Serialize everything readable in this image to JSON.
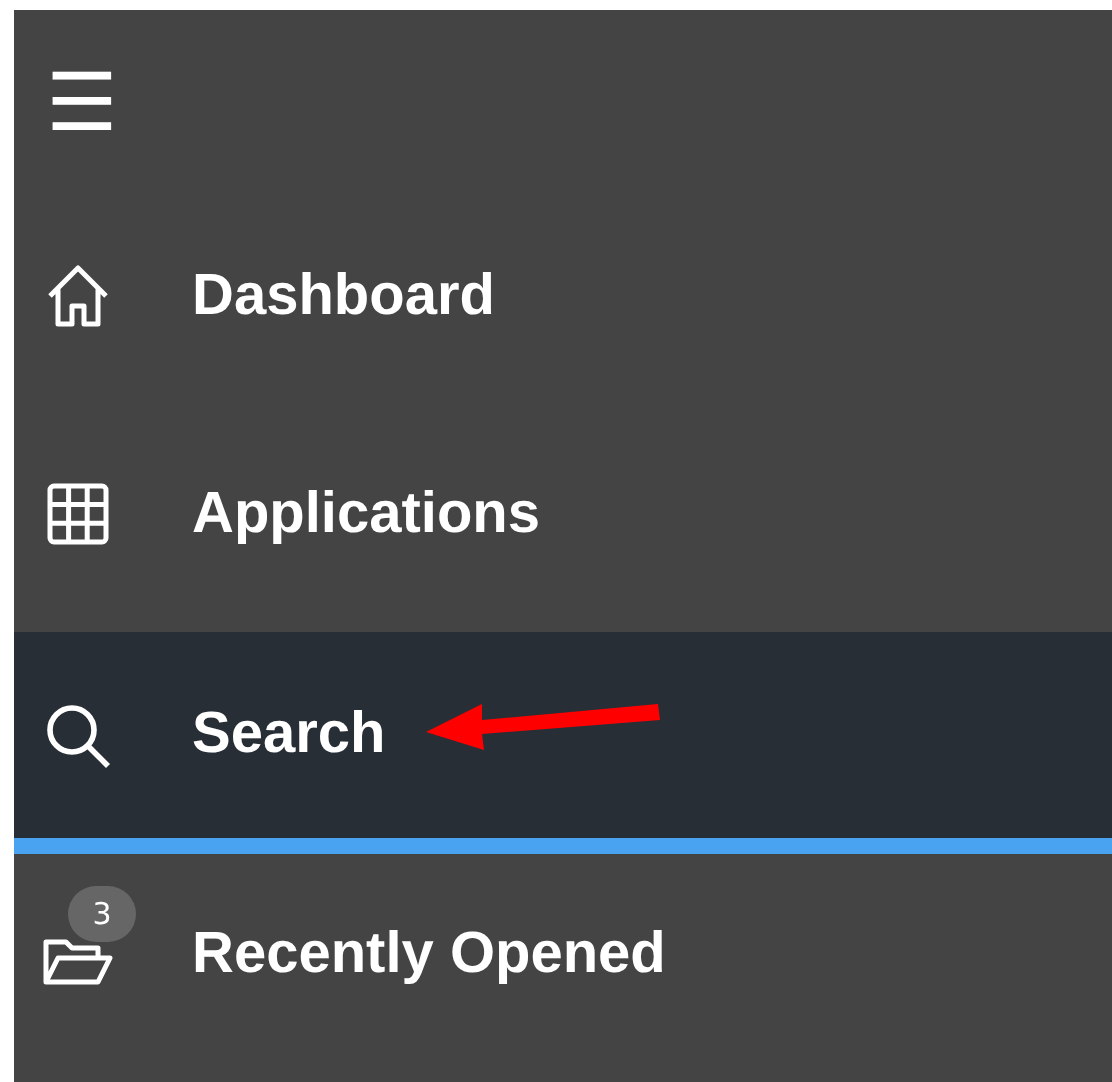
{
  "menu_button": {
    "icon": "☰"
  },
  "sidebar": {
    "items": [
      {
        "label": "Dashboard",
        "kind": "home",
        "selected": false,
        "pointer_arrow": false
      },
      {
        "label": "Applications",
        "kind": "grid",
        "selected": false,
        "pointer_arrow": false
      },
      {
        "label": "Search",
        "kind": "search",
        "selected": true,
        "pointer_arrow": true
      },
      {
        "label": "Recently Opened",
        "kind": "folder",
        "selected": false,
        "pointer_arrow": false,
        "badge": "3"
      }
    ]
  }
}
